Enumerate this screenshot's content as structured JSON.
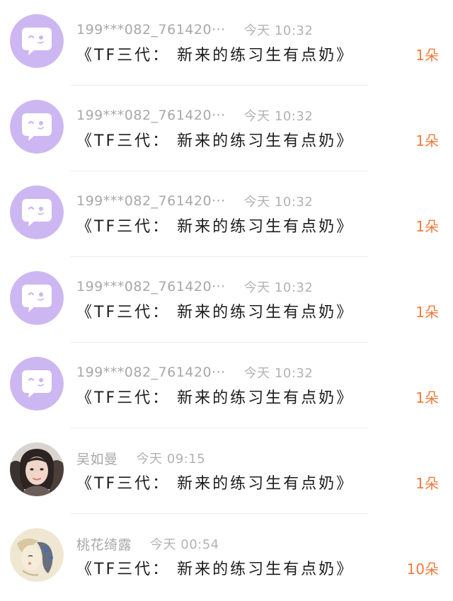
{
  "gift_list": {
    "items": [
      {
        "avatar": "purple-chat-avatar-icon",
        "name": "199***082_761420···",
        "time": "今天 10:32",
        "title": "《TF三代： 新来的练习生有点奶》",
        "count": "1朵"
      },
      {
        "avatar": "purple-chat-avatar-icon",
        "name": "199***082_761420···",
        "time": "今天 10:32",
        "title": "《TF三代： 新来的练习生有点奶》",
        "count": "1朵"
      },
      {
        "avatar": "purple-chat-avatar-icon",
        "name": "199***082_761420···",
        "time": "今天 10:32",
        "title": "《TF三代： 新来的练习生有点奶》",
        "count": "1朵"
      },
      {
        "avatar": "purple-chat-avatar-icon",
        "name": "199***082_761420···",
        "time": "今天 10:32",
        "title": "《TF三代： 新来的练习生有点奶》",
        "count": "1朵"
      },
      {
        "avatar": "purple-chat-avatar-icon",
        "name": "199***082_761420···",
        "time": "今天 10:32",
        "title": "《TF三代： 新来的练习生有点奶》",
        "count": "1朵"
      },
      {
        "avatar": "user-photo-avatar",
        "name": "吴如曼",
        "time": "今天 09:15",
        "title": "《TF三代： 新来的练习生有点奶》",
        "count": "1朵"
      },
      {
        "avatar": "illustration-avatar",
        "name": "桃花绮露",
        "time": "今天 00:54",
        "title": "《TF三代： 新来的练习生有点奶》",
        "count": "10朵"
      }
    ]
  },
  "colors": {
    "avatar_purple": "#cdb7f2",
    "count_orange": "#f27a3a",
    "meta_gray": "#a8a8a8"
  }
}
